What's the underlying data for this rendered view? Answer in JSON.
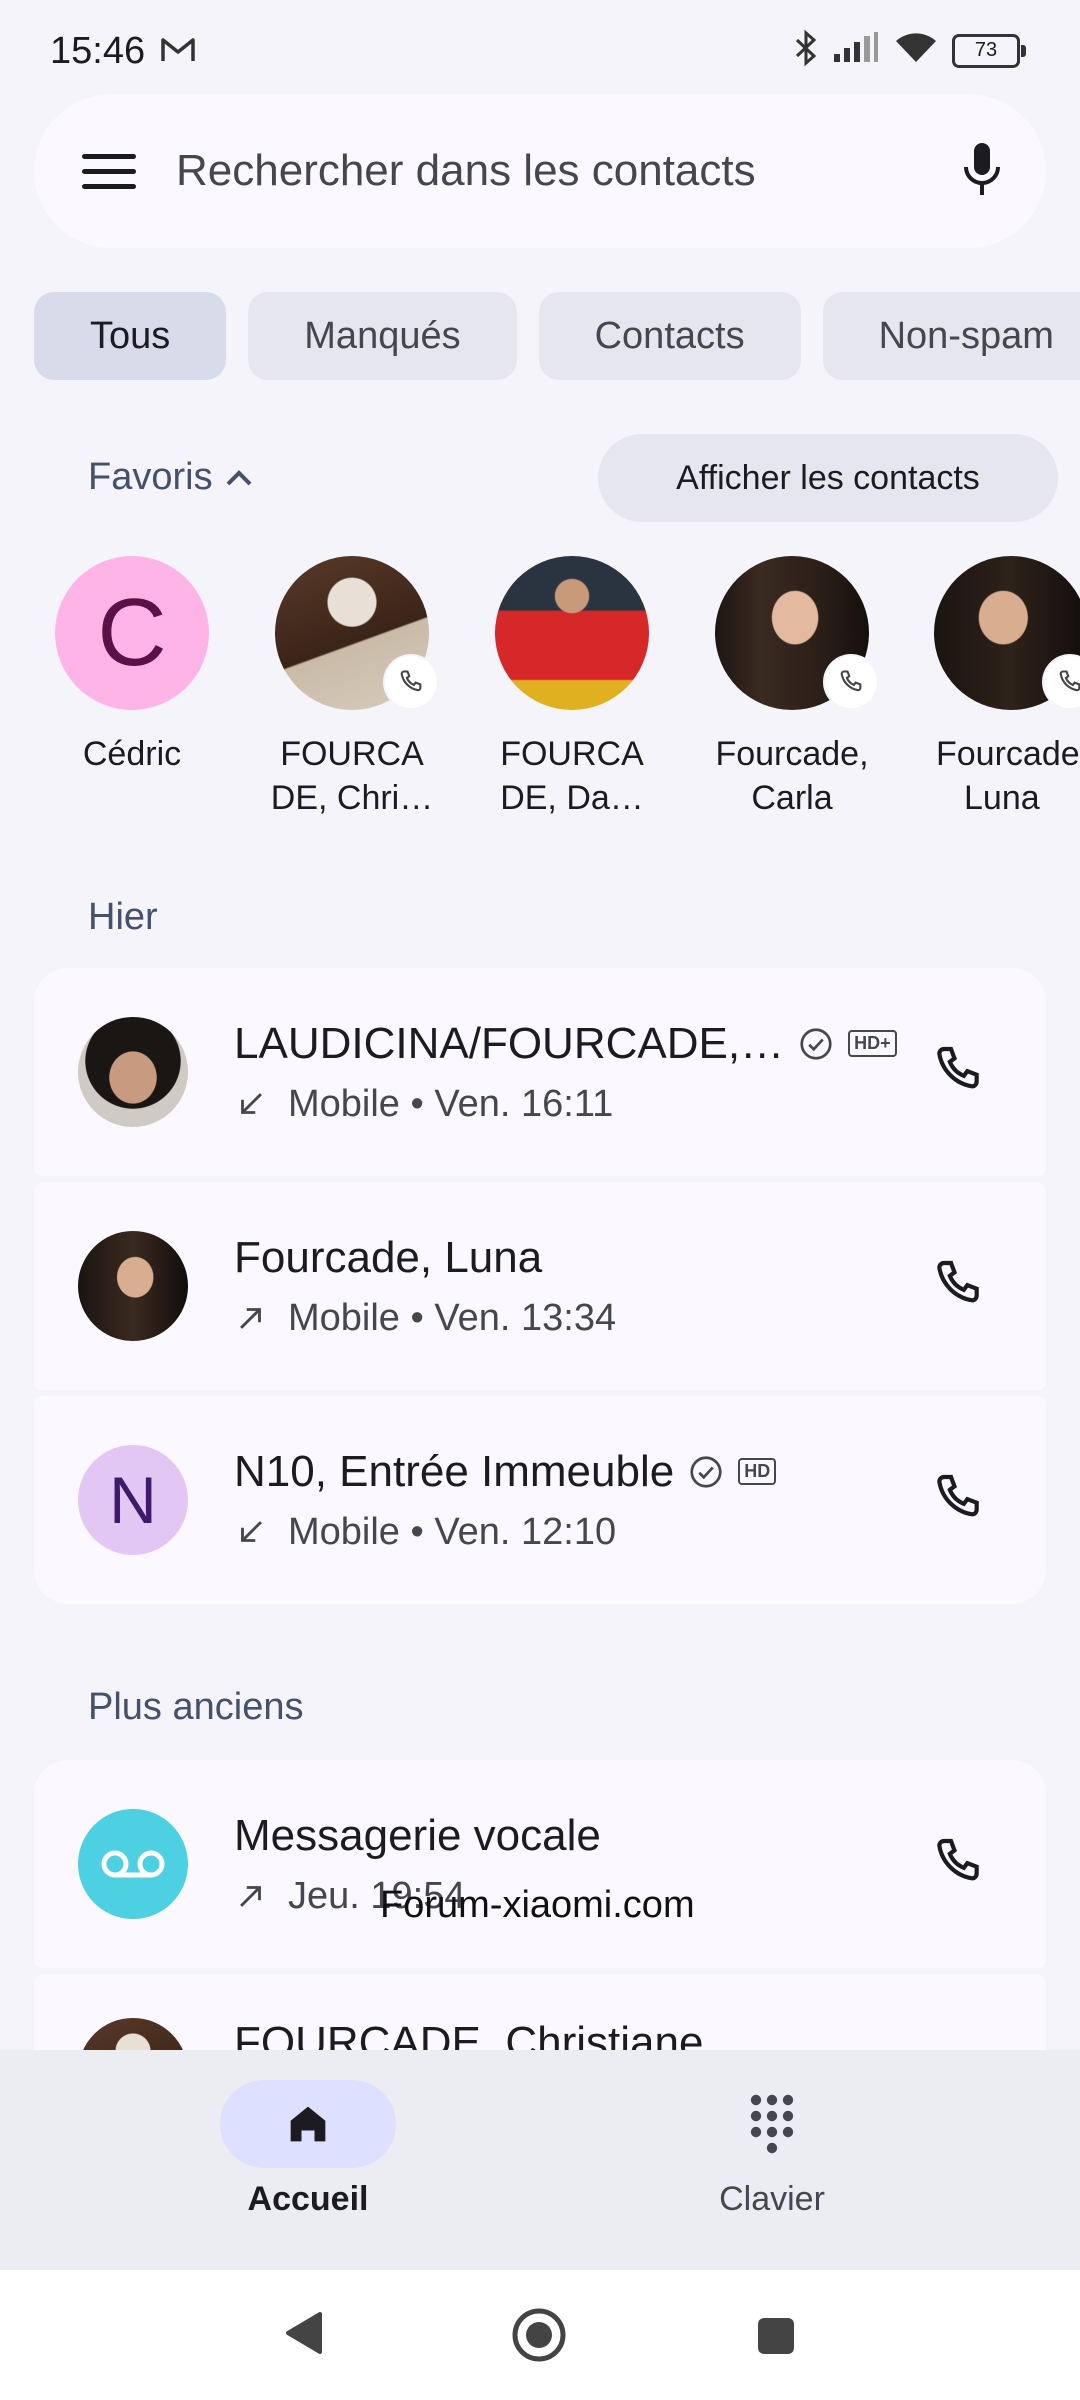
{
  "status_bar": {
    "time": "15:46",
    "battery": "73"
  },
  "search": {
    "placeholder": "Rechercher dans les contacts"
  },
  "chips": [
    {
      "label": "Tous"
    },
    {
      "label": "Manqués"
    },
    {
      "label": "Contacts"
    },
    {
      "label": "Non-spam"
    }
  ],
  "favorites": {
    "title": "Favoris",
    "show_contacts": "Afficher les contacts",
    "items": [
      {
        "initial": "C",
        "line1": "Cédric",
        "line2": ""
      },
      {
        "line1": "FOURCA",
        "line2": "DE, Chri…"
      },
      {
        "line1": "FOURCA",
        "line2": "DE, Da…"
      },
      {
        "line1": "Fourcade,",
        "line2": "Carla"
      },
      {
        "line1": "Fourcade",
        "line2": "Luna"
      }
    ]
  },
  "sections": {
    "yesterday": "Hier",
    "older": "Plus anciens"
  },
  "calls": [
    {
      "name": "LAUDICINA/FOURCADE,…",
      "meta": "Mobile • Ven. 16:11",
      "direction": "incoming",
      "verified": true,
      "hd": "HD+"
    },
    {
      "name": "Fourcade, Luna",
      "meta": "Mobile • Ven. 13:34",
      "direction": "outgoing"
    },
    {
      "initial": "N",
      "name": "N10, Entrée Immeuble",
      "meta": "Mobile • Ven. 12:10",
      "direction": "incoming",
      "verified": true,
      "hd": "HD"
    },
    {
      "name": "Messagerie vocale",
      "meta": "Jeu. 19:54",
      "direction": "outgoing"
    },
    {
      "name": "FOURCADE, Christiane"
    }
  ],
  "watermark": "Forum-xiaomi.com",
  "bottom_nav": {
    "home": "Accueil",
    "keypad": "Clavier"
  },
  "colors": {
    "accent_pill": "#dde1ff",
    "voicemail": "#4dd0e1",
    "avatar_c": "#ffb4e8",
    "avatar_n": "#e2c7f5"
  }
}
